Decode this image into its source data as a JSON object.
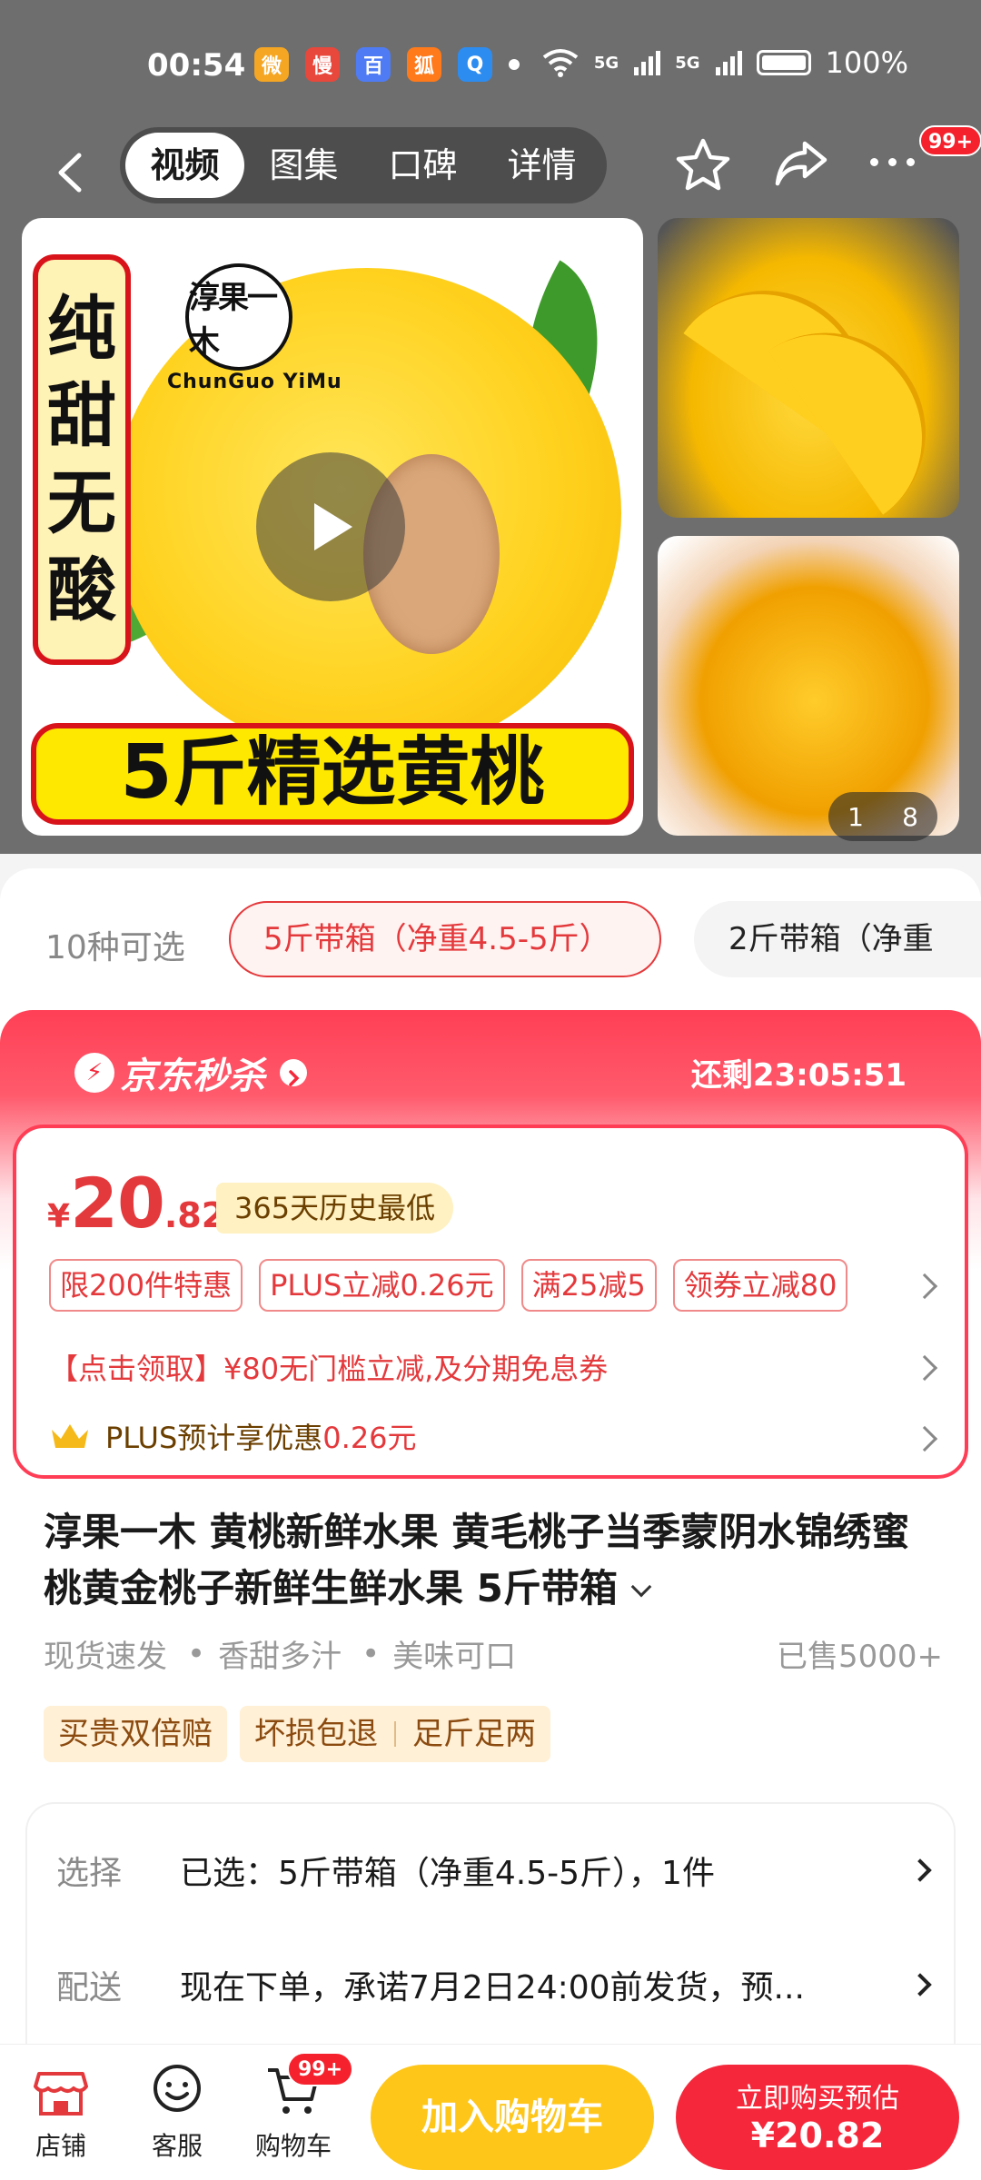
{
  "status_bar": {
    "time": "00:54",
    "apps": [
      {
        "name": "weibo-icon",
        "label": "微",
        "color": "#f5a623"
      },
      {
        "name": "manman-icon",
        "label": "慢",
        "color": "#e8473b"
      },
      {
        "name": "baidu-icon",
        "label": "百",
        "color": "#4f7cf5"
      },
      {
        "name": "fox-icon",
        "label": "狐",
        "color": "#ff7a1a"
      },
      {
        "name": "search-app-icon",
        "label": "Q",
        "color": "#2d8cf0"
      }
    ],
    "signal_1": "5G",
    "signal_2": "5G",
    "battery": "100%"
  },
  "nav": {
    "tabs": [
      "视频",
      "图集",
      "口碑",
      "详情"
    ],
    "active_tab": 0,
    "more_badge": "99+"
  },
  "hero": {
    "slogan_vertical": [
      "纯",
      "甜",
      "无",
      "酸"
    ],
    "logo_text": "淳果一木",
    "logo_sub": "ChunGuo YiMu",
    "slogan_bottom": "5斤精选黄桃",
    "page_current": "1",
    "page_total": "8"
  },
  "spec": {
    "count": "10种可选",
    "selected": "5斤带箱（净重4.5-5斤）",
    "other": "2斤带箱（净重"
  },
  "flash": {
    "brand": "京东秒杀",
    "timer": "还剩23:05:51",
    "price_symbol": "¥",
    "price_int": "20",
    "price_dec": ".82",
    "low_badge": "365天历史最低",
    "coupons": [
      "限200件特惠",
      "PLUS立减0.26元",
      "满25减5",
      "领券立减80"
    ],
    "promo": "【点击领取】¥80无门槛立减,及分期免息券",
    "plus_prefix": "PLUS预计享优惠",
    "plus_value": "0.26元"
  },
  "product": {
    "title": "淳果一木 黄桃新鲜水果 黄毛桃子当季蒙阴水锦绣蜜桃黄金桃子新鲜生鲜水果 5斤带箱",
    "tags": [
      "现货速发",
      "香甜多汁",
      "美味可口"
    ],
    "sold": "已售5000+",
    "guarantee_1": "买贵双倍赔",
    "guarantee_2": "坏损包退",
    "guarantee_3": "足斤足两"
  },
  "info": {
    "select_label": "选择",
    "select_value": "已选：5斤带箱（净重4.5-5斤），1件",
    "delivery_label": "配送",
    "delivery_value": "现在下单，承诺7月2日24:00前发货，预..."
  },
  "bottom_bar": {
    "store": "店铺",
    "service": "客服",
    "cart": "购物车",
    "cart_badge": "99+",
    "add_cart": "加入购物车",
    "buy_line1": "立即购买预估",
    "buy_line2": "¥20.82"
  },
  "colors": {
    "accent_red": "#e4393c",
    "cart_yellow": "#ffc61a",
    "buy_red": "#f5283b"
  }
}
